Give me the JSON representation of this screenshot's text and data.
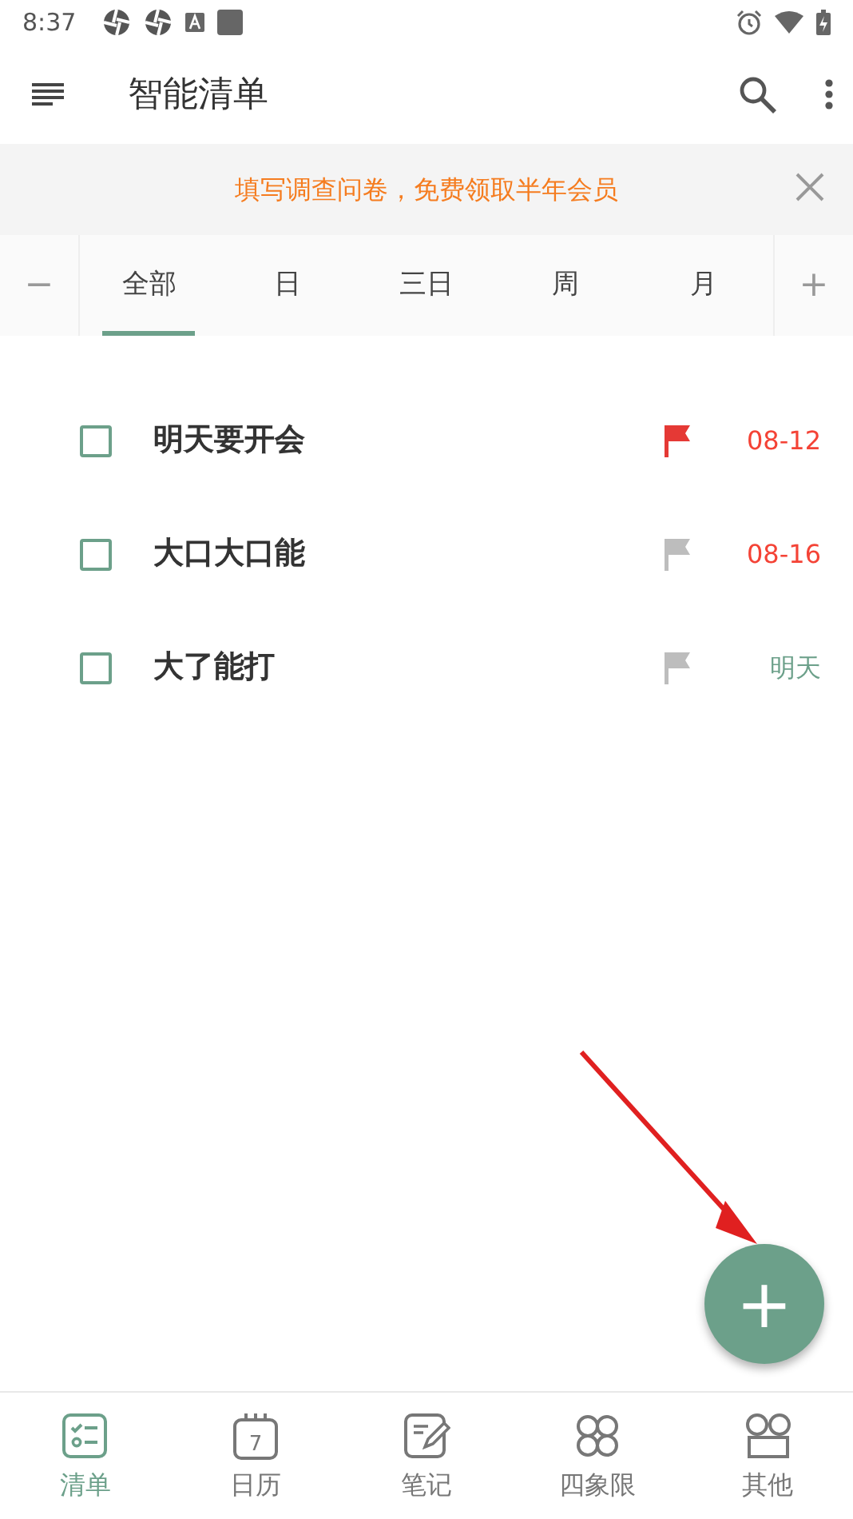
{
  "status_bar": {
    "time": "8:37"
  },
  "app_bar": {
    "title": "智能清单"
  },
  "banner": {
    "text": "填写调查问卷，免费领取半年会员"
  },
  "range_tabs": {
    "minus": "−",
    "plus": "+",
    "tabs": [
      {
        "label": "全部",
        "selected": true
      },
      {
        "label": "日",
        "selected": false
      },
      {
        "label": "三日",
        "selected": false
      },
      {
        "label": "周",
        "selected": false
      },
      {
        "label": "月",
        "selected": false
      }
    ]
  },
  "tasks": [
    {
      "title": "明天要开会",
      "checked": false,
      "flagged": true,
      "date": "08-12",
      "color": "#f44336"
    },
    {
      "title": "大口大口能",
      "checked": false,
      "flagged": false,
      "date": "08-16",
      "color": "#f44336"
    },
    {
      "title": "大了能打",
      "checked": false,
      "flagged": false,
      "date": "明天",
      "color": "#6ca08a"
    }
  ],
  "fab": {
    "symbol": "+"
  },
  "bottom_nav": [
    {
      "label": "清单",
      "kind": "checklist",
      "selected": true
    },
    {
      "label": "日历",
      "kind": "calendar",
      "icon_text": "7",
      "selected": false
    },
    {
      "label": "笔记",
      "kind": "note",
      "selected": false
    },
    {
      "label": "四象限",
      "kind": "quadrant",
      "selected": false
    },
    {
      "label": "其他",
      "kind": "more",
      "selected": false
    }
  ]
}
